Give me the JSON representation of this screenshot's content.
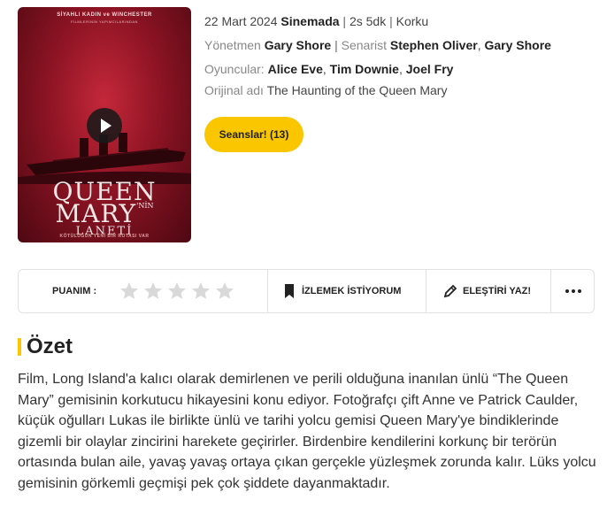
{
  "poster": {
    "top_line": "SİYAHLI KADIN ve WINCHESTER",
    "top_subline": "FİLMLERİNİN YAPIMCILARINDAN",
    "logo_line1": "QUEEN",
    "logo_line2": "MARY",
    "logo_suffix": "'NİN",
    "logo_line3": "LANETİ",
    "tagline": "KÖTÜLÜĞÜN YENİ BİR ROTASI VAR"
  },
  "meta": {
    "date": "22 Mart 2024",
    "status": "Sinemada",
    "sep": "|",
    "duration": "2s 5dk",
    "genre": "Korku",
    "director_label": "Yönetmen",
    "director": "Gary Shore",
    "writer_label": "Senarist",
    "writer1": "Stephen Oliver",
    "writer2": "Gary Shore",
    "cast_label": "Oyuncular:",
    "cast1": "Alice Eve",
    "cast2": "Tim Downie",
    "cast3": "Joel Fry",
    "original_label": "Orijinal adı",
    "original_title": "The Haunting of the Queen Mary"
  },
  "sessions_button": "Seanslar! (13)",
  "actions": {
    "rating_label": "PUANIM :",
    "rating_value": 0,
    "rating_max": 5,
    "watchlist_label": "İZLEMEK İSTİYORUM",
    "critic_label": "ELEŞTİRİ YAZ!",
    "more_icon": "more-dots-icon"
  },
  "summary": {
    "title": "Özet",
    "text": "Film, Long Island'a kalıcı olarak demirlenen ve perili olduğuna inanılan ünlü “The Queen Mary” gemisinin korkutucu hikayesini konu ediyor. Fotoğrafçı çift Anne ve Patrick Caulder, küçük oğulları Lukas ile birlikte ünlü ve tarihi yolcu gemisi Queen Mary'ye bindiklerinde gizemli bir olaylar zincirini harekete geçirirler. Birdenbire kendilerini korkunç bir terörün ortasında bulan aile, yavaş yavaş ortaya çıkan gerçekle yüzleşmek zorunda kalır. Lüks yolcu gemisinin görkemli geçmişi pek çok şiddete dayanmaktadır."
  },
  "colors": {
    "accent": "#f9c600",
    "star_empty": "#d9d9d9"
  }
}
